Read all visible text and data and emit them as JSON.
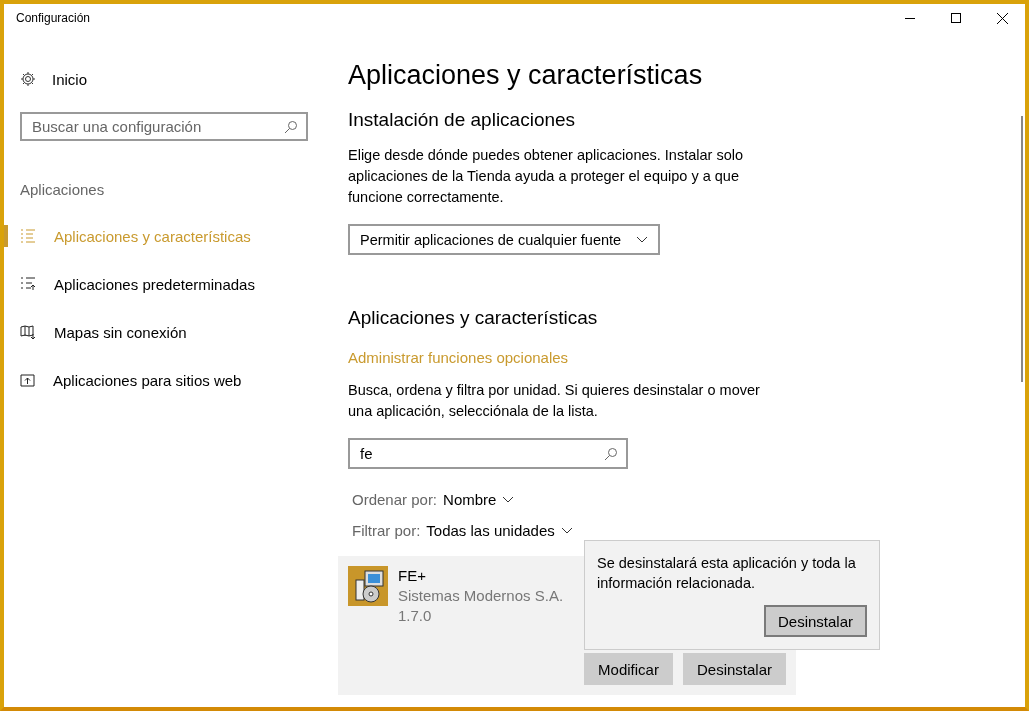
{
  "window": {
    "title": "Configuración"
  },
  "sidebar": {
    "home": "Inicio",
    "search_placeholder": "Buscar una configuración",
    "section": "Aplicaciones",
    "items": [
      {
        "label": "Aplicaciones y características",
        "selected": true
      },
      {
        "label": "Aplicaciones predeterminadas",
        "selected": false
      },
      {
        "label": "Mapas sin conexión",
        "selected": false
      },
      {
        "label": "Aplicaciones para sitios web",
        "selected": false
      }
    ]
  },
  "main": {
    "title": "Aplicaciones y características",
    "install": {
      "heading": "Instalación de aplicaciones",
      "description": "Elige desde dónde puedes obtener aplicaciones. Instalar solo aplicaciones de la Tienda ayuda a proteger el equipo y a que funcione correctamente.",
      "dropdown": "Permitir aplicaciones de cualquier fuente"
    },
    "apps": {
      "heading": "Aplicaciones y características",
      "link": "Administrar funciones opcionales",
      "description": "Busca, ordena y filtra por unidad. Si quieres desinstalar o mover una aplicación, selecciónala de la lista.",
      "search_value": "fe",
      "sort_label": "Ordenar por:",
      "sort_value": "Nombre",
      "filter_label": "Filtrar por:",
      "filter_value": "Todas las unidades",
      "list": [
        {
          "name": "FE+",
          "publisher": "Sistemas Modernos S.A.",
          "version": "1.7.0",
          "selected": true,
          "buttons": [
            "Modificar",
            "Desinstalar"
          ]
        }
      ]
    },
    "flyout": {
      "text": "Se desinstalará esta aplicación y toda la información relacionada.",
      "button": "Desinstalar"
    }
  }
}
